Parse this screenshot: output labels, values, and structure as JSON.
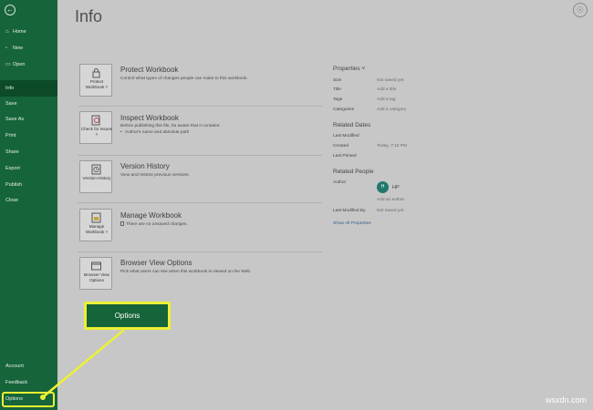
{
  "sidebar": {
    "items": [
      {
        "label": "Home",
        "icon": "home-icon",
        "glyph": "⌂"
      },
      {
        "label": "New",
        "icon": "new-icon",
        "glyph": "▫"
      },
      {
        "label": "Open",
        "icon": "open-icon",
        "glyph": "▭"
      },
      {
        "label": "Info",
        "active": true
      },
      {
        "label": "Save"
      },
      {
        "label": "Save As"
      },
      {
        "label": "Print"
      },
      {
        "label": "Share"
      },
      {
        "label": "Export"
      },
      {
        "label": "Publish"
      },
      {
        "label": "Close"
      }
    ],
    "bottom_items": [
      {
        "label": "Account"
      },
      {
        "label": "Feedback"
      },
      {
        "label": "Options"
      }
    ]
  },
  "main": {
    "title": "Info",
    "sections": [
      {
        "button_label": "Protect Workbook ˅",
        "title": "Protect Workbook",
        "desc": "Control what types of changes people can make to this workbook.",
        "icon": "lock-icon"
      },
      {
        "button_label": "Check for Issues ˅",
        "title": "Inspect Workbook",
        "desc": "Before publishing this file, be aware that it contains:",
        "bullet": "Author's name and absolute path",
        "icon": "inspect-icon"
      },
      {
        "button_label": "Version History",
        "title": "Version History",
        "desc": "View and restore previous versions.",
        "icon": "history-icon"
      },
      {
        "button_label": "Manage Workbook ˅",
        "title": "Manage Workbook",
        "desc": "There are no unsaved changes.",
        "icon": "manage-icon"
      },
      {
        "button_label": "Browser View Options",
        "title": "Browser View Options",
        "desc": "Pick what users can see when this workbook is viewed on the Web.",
        "icon": "browser-icon"
      }
    ]
  },
  "properties": {
    "heading": "Properties ˅",
    "rows": [
      {
        "key": "Size",
        "value": "Not saved yet"
      },
      {
        "key": "Title",
        "value": "Add a title"
      },
      {
        "key": "Tags",
        "value": "Add a tag"
      },
      {
        "key": "Categories",
        "value": "Add a category"
      }
    ],
    "dates_heading": "Related Dates",
    "dates": [
      {
        "key": "Last Modified",
        "value": ""
      },
      {
        "key": "Created",
        "value": "Today, 7:10 PM"
      },
      {
        "key": "Last Printed",
        "value": ""
      }
    ],
    "people_heading": "Related People",
    "author_key": "Author",
    "author_initial": "H",
    "author_name": "HP",
    "add_author": "Add an author",
    "last_modified_by_key": "Last Modified By",
    "last_modified_by_value": "Not saved yet",
    "show_all": "Show All Properties"
  },
  "callout": {
    "label": "Options",
    "highlight_color": "#ECF135"
  },
  "colors": {
    "sidebar_green": "#16643A",
    "active_item": "#0C4A28",
    "background": "#C7C7C7"
  },
  "watermark": "wsxdn.com"
}
